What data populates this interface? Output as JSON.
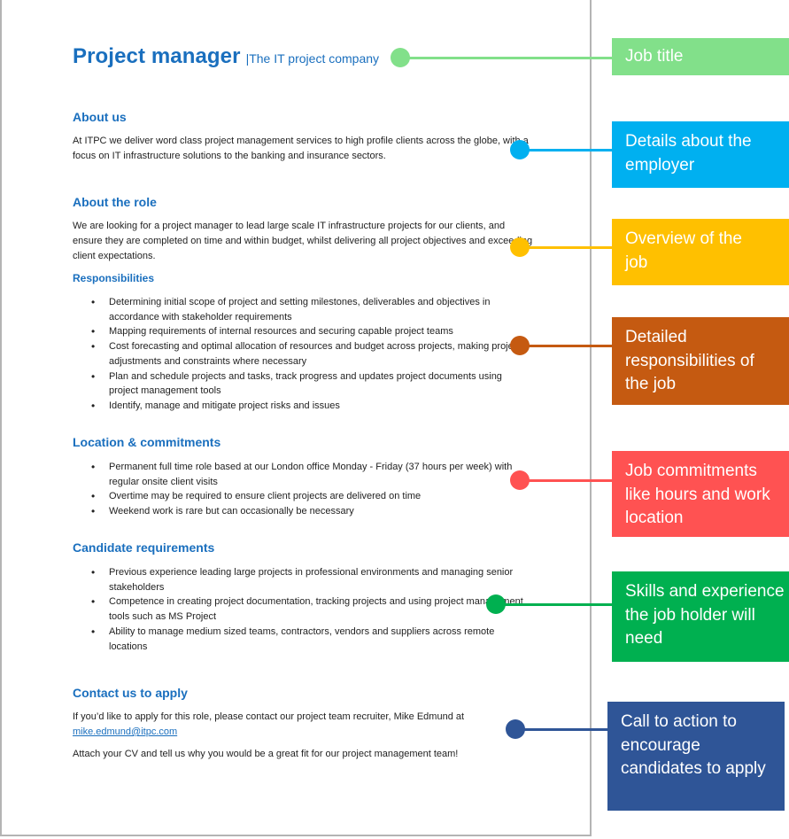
{
  "document": {
    "title": "Project manager",
    "subtitle": "|The IT project company",
    "sections": {
      "about_us": {
        "heading": "About us",
        "body": "At ITPC we deliver word class project management services to high profile clients across the globe, with a focus on IT infrastructure solutions to the banking and insurance sectors."
      },
      "about_role": {
        "heading": "About the role",
        "body": "We are looking for a project manager to lead large scale IT infrastructure projects for our clients, and ensure they are completed on time and within budget, whilst delivering all project objectives and exceeding client expectations."
      },
      "responsibilities": {
        "heading": "Responsibilities",
        "items": [
          "Determining initial scope of project and setting milestones, deliverables and objectives in accordance with stakeholder requirements",
          "Mapping requirements of internal resources and securing capable project teams",
          "Cost forecasting and optimal allocation of resources and budget across projects, making project adjustments and constraints where necessary",
          "Plan and schedule projects and tasks, track progress and updates project documents using project management tools",
          "Identify, manage and mitigate project risks and issues"
        ]
      },
      "location": {
        "heading": "Location & commitments",
        "items": [
          "Permanent full time role based at our London office Monday - Friday (37 hours per week) with regular onsite client visits",
          "Overtime may be required to ensure client projects are delivered on time",
          "Weekend work is rare but can occasionally be necessary"
        ]
      },
      "requirements": {
        "heading": "Candidate requirements",
        "items": [
          "Previous experience leading large projects in professional environments and managing senior stakeholders",
          "Competence in creating project documentation, tracking projects and using project management tools such as MS Project",
          "Ability to manage medium sized teams, contractors, vendors and suppliers across remote locations"
        ]
      },
      "contact": {
        "heading": "Contact us to apply",
        "body": "If you’d like to apply for this role, please contact our project team recruiter, Mike Edmund at",
        "email": "mike.edmund@itpc.com",
        "closing": "Attach your CV and tell us why you would be a great fit for our project management team!"
      }
    }
  },
  "callouts": [
    {
      "label": "Job title",
      "color": "#82e08a"
    },
    {
      "label": "Details about the employer",
      "color": "#00b0f0"
    },
    {
      "label": "Overview of the job",
      "color": "#ffc000"
    },
    {
      "label": "Detailed responsibilities of the job",
      "color": "#c55a11"
    },
    {
      "label": "Job commitments like hours and work location",
      "color": "#ff5252"
    },
    {
      "label": "Skills and experience the job holder will need",
      "color": "#00b050"
    },
    {
      "label": "Call to action to encourage candidates to apply",
      "color": "#2f5597"
    }
  ]
}
